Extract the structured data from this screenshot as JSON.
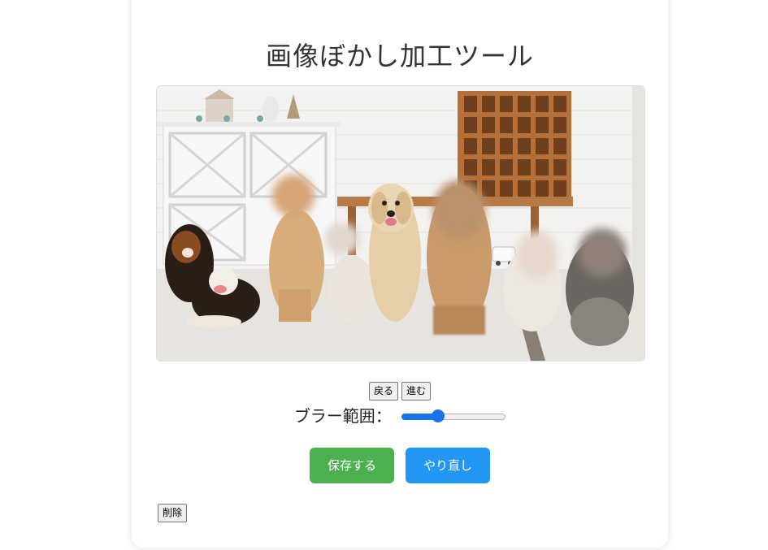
{
  "title": "画像ぼかし加工ツール",
  "history": {
    "back_label": "戻る",
    "forward_label": "進む"
  },
  "blur": {
    "label": "ブラー範囲：",
    "value_fraction": 0.35
  },
  "actions": {
    "save_label": "保存する",
    "redo_label": "やり直し"
  },
  "delete_label": "削除",
  "colors": {
    "save": "#4caf50",
    "redo": "#2196f3",
    "slider": "#1a73e8"
  }
}
